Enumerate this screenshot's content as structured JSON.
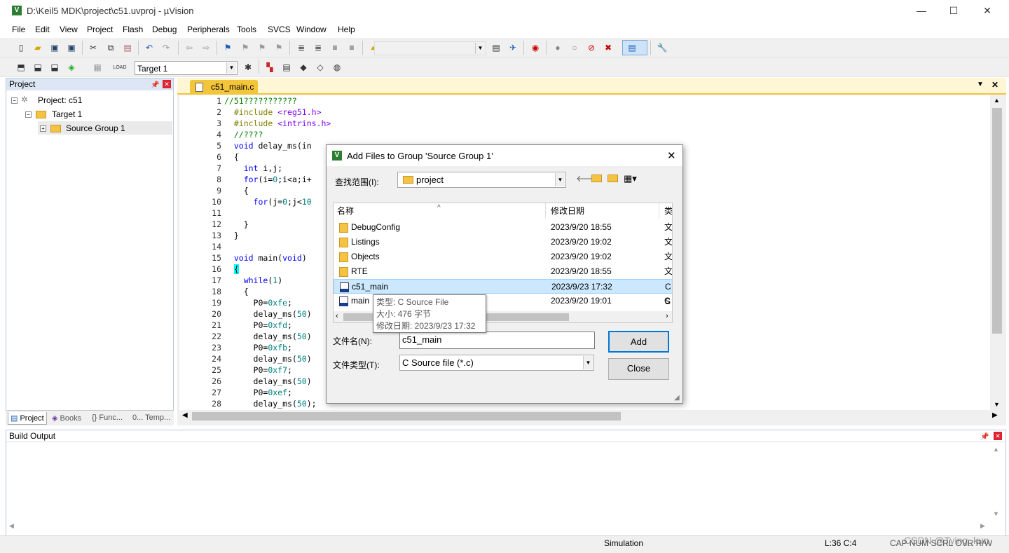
{
  "window": {
    "title": "D:\\Keil5 MDK\\project\\c51.uvproj - µVision",
    "logo": "V",
    "minimize": "—",
    "maximize": "☐",
    "close": "✕"
  },
  "menu": [
    "File",
    "Edit",
    "View",
    "Project",
    "Flash",
    "Debug",
    "Peripherals",
    "Tools",
    "SVCS",
    "Window",
    "Help"
  ],
  "toolbar2": {
    "target": "Target 1"
  },
  "project_panel": {
    "header": "Project",
    "tree": {
      "root": "Project: c51",
      "target": "Target 1",
      "group": "Source Group 1"
    },
    "tabs": [
      "Project",
      "Books",
      "{} Func...",
      "0... Temp..."
    ]
  },
  "editor": {
    "tab": "c51_main.c",
    "lines": [
      "1",
      "2",
      "3",
      "4",
      "5",
      "6",
      "7",
      "8",
      "9",
      "10",
      "11",
      "12",
      "13",
      "14",
      "15",
      "16",
      "17",
      "18",
      "19",
      "20",
      "21",
      "22",
      "23",
      "24",
      "25",
      "26",
      "27",
      "28"
    ]
  },
  "build": {
    "header": "Build Output"
  },
  "status": {
    "mode": "Simulation",
    "pos": "L:36 C:4",
    "caps": "CAP NUM SCRL OVR R/W",
    "watermark": "CSDN @Tying_kun"
  },
  "dialog": {
    "title": "Add Files to Group 'Source Group 1'",
    "lookin_label": "查找范围(I):",
    "lookin_value": "project",
    "col_name": "名称",
    "col_date": "修改日期",
    "col_type": "类",
    "files": [
      {
        "name": "DebugConfig",
        "date": "2023/9/20 18:55",
        "type": "文",
        "kind": "folder"
      },
      {
        "name": "Listings",
        "date": "2023/9/20 19:02",
        "type": "文",
        "kind": "folder"
      },
      {
        "name": "Objects",
        "date": "2023/9/20 19:02",
        "type": "文",
        "kind": "folder"
      },
      {
        "name": "RTE",
        "date": "2023/9/20 18:55",
        "type": "文",
        "kind": "folder"
      },
      {
        "name": "c51_main",
        "date": "2023/9/23 17:32",
        "type": "C S",
        "kind": "file"
      },
      {
        "name": "main",
        "date": "2023/9/20 19:01",
        "type": "C S",
        "kind": "file"
      }
    ],
    "filename_label": "文件名(N):",
    "filename_value": "c51_main",
    "filetype_label": "文件类型(T):",
    "filetype_value": "C Source file (*.c)",
    "add": "Add",
    "close": "Close",
    "tooltip": {
      "type": "类型: C Source File",
      "size": "大小: 476 字节",
      "date": "修改日期: 2023/9/23 17:32"
    }
  },
  "colors": {
    "accent": "#f3c53b",
    "select": "#cce8ff",
    "panel_header": "#dce6f4"
  }
}
